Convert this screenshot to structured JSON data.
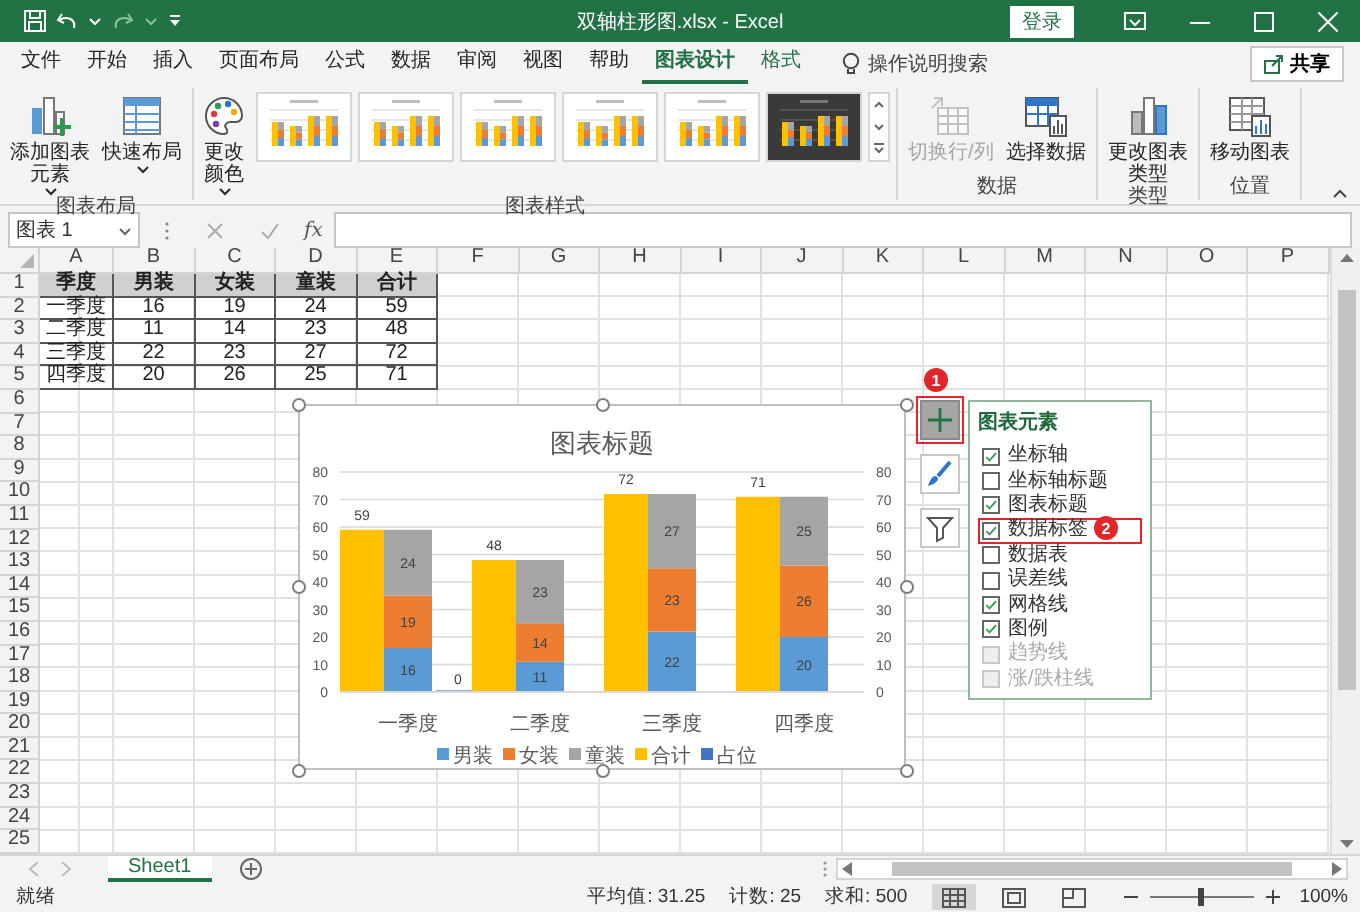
{
  "title_bar": {
    "title": "双轴柱形图.xlsx - Excel",
    "login_button": "登录"
  },
  "ribbon_tabs": [
    {
      "label": "文件",
      "selected": false,
      "contextual": false
    },
    {
      "label": "开始",
      "selected": false,
      "contextual": false
    },
    {
      "label": "插入",
      "selected": false,
      "contextual": false
    },
    {
      "label": "页面布局",
      "selected": false,
      "contextual": false
    },
    {
      "label": "公式",
      "selected": false,
      "contextual": false
    },
    {
      "label": "数据",
      "selected": false,
      "contextual": false
    },
    {
      "label": "审阅",
      "selected": false,
      "contextual": false
    },
    {
      "label": "视图",
      "selected": false,
      "contextual": false
    },
    {
      "label": "帮助",
      "selected": false,
      "contextual": false
    },
    {
      "label": "图表设计",
      "selected": true,
      "contextual": true
    },
    {
      "label": "格式",
      "selected": false,
      "contextual": true
    }
  ],
  "tell_me": {
    "placeholder": "操作说明搜索"
  },
  "share_button": "共享",
  "ribbon_groups": [
    {
      "label": "图表布局",
      "buttons": [
        {
          "kind": "add_element",
          "label": "添加图表元素",
          "disabled": false,
          "has_menu": true
        },
        {
          "kind": "quick_layout",
          "label": "快速布局",
          "disabled": false,
          "has_menu": true
        }
      ]
    },
    {
      "label": "图表样式",
      "buttons": [
        {
          "kind": "change_colors",
          "label": "更改颜色",
          "disabled": false,
          "has_menu": true
        }
      ],
      "styles": [
        {
          "kind": "light"
        },
        {
          "kind": "light"
        },
        {
          "kind": "light"
        },
        {
          "kind": "light"
        },
        {
          "kind": "light"
        },
        {
          "kind": "dark"
        }
      ]
    },
    {
      "label": "数据",
      "buttons": [
        {
          "kind": "switch_row_column",
          "label": "切换行/列",
          "disabled": true,
          "has_menu": false
        },
        {
          "kind": "select_data",
          "label": "选择数据",
          "disabled": false,
          "has_menu": false
        }
      ]
    },
    {
      "label": "类型",
      "buttons": [
        {
          "kind": "change_type",
          "label": "更改图表类型",
          "disabled": false,
          "has_menu": false
        }
      ]
    },
    {
      "label": "位置",
      "buttons": [
        {
          "kind": "move_chart",
          "label": "移动图表",
          "disabled": false,
          "has_menu": false
        }
      ]
    }
  ],
  "formula_bar": {
    "name_box": "图表 1",
    "function_button": "fx"
  },
  "sheet": {
    "columns": [
      "A",
      "B",
      "C",
      "D",
      "E",
      "F",
      "G",
      "H",
      "I",
      "J",
      "K",
      "L",
      "M",
      "N",
      "O",
      "P"
    ],
    "rows": [
      "1",
      "2",
      "3",
      "4",
      "5",
      "6",
      "7",
      "8",
      "9",
      "10",
      "11",
      "12",
      "13",
      "14",
      "15",
      "16",
      "17",
      "18",
      "19",
      "20",
      "21",
      "22",
      "23",
      "24",
      "25"
    ],
    "table": [
      [
        "季度",
        "男装",
        "女装",
        "童装",
        "合计"
      ],
      [
        "一季度",
        "16",
        "19",
        "24",
        "59"
      ],
      [
        "二季度",
        "11",
        "14",
        "23",
        "48"
      ],
      [
        "三季度",
        "22",
        "23",
        "27",
        "72"
      ],
      [
        "四季度",
        "20",
        "26",
        "25",
        "71"
      ]
    ]
  },
  "chart": {
    "selected": true,
    "chart_data": {
      "type": "bar",
      "title": "图表标题",
      "categories": [
        "一季度",
        "二季度",
        "三季度",
        "四季度"
      ],
      "series": [
        {
          "name": "男装",
          "color": "#5b9bd5",
          "values": [
            16,
            11,
            22,
            20
          ],
          "axis": "y2",
          "value_labels": [
            "16",
            "11",
            "22",
            "20"
          ]
        },
        {
          "name": "女装",
          "color": "#ed7d31",
          "values": [
            19,
            14,
            23,
            26
          ],
          "axis": "y2",
          "value_labels": [
            "19",
            "14",
            "23",
            "26"
          ]
        },
        {
          "name": "童装",
          "color": "#a5a5a5",
          "values": [
            24,
            23,
            27,
            25
          ],
          "axis": "y2",
          "value_labels": [
            "24",
            "23",
            "27",
            "25"
          ]
        },
        {
          "name": "合计",
          "color": "#ffc000",
          "values": [
            59,
            48,
            72,
            71
          ],
          "value_labels": [
            "59",
            "48",
            "72",
            "71"
          ]
        },
        {
          "name": "占位",
          "color": "#4472c4",
          "values": [
            0,
            null,
            null,
            null
          ]
        }
      ],
      "annotations": [
        "0"
      ],
      "ylim": [
        0,
        80
      ],
      "yticks": [
        {
          "value": 0,
          "label": "0"
        },
        {
          "value": 10,
          "label": "10"
        },
        {
          "value": 20,
          "label": "20"
        },
        {
          "value": 30,
          "label": "30"
        },
        {
          "value": 40,
          "label": "40"
        },
        {
          "value": 50,
          "label": "50"
        },
        {
          "value": 60,
          "label": "60"
        },
        {
          "value": 70,
          "label": "70"
        },
        {
          "value": 80,
          "label": "80"
        }
      ],
      "y2lim": [
        0,
        80
      ],
      "y2ticks": [
        {
          "value": 0,
          "label": "0"
        },
        {
          "value": 10,
          "label": "10"
        },
        {
          "value": 20,
          "label": "20"
        },
        {
          "value": 30,
          "label": "30"
        },
        {
          "value": 40,
          "label": "40"
        },
        {
          "value": 50,
          "label": "50"
        },
        {
          "value": 60,
          "label": "60"
        },
        {
          "value": 70,
          "label": "70"
        },
        {
          "value": 80,
          "label": "80"
        }
      ],
      "stacked": true,
      "grid": true,
      "legend": "bottom"
    }
  },
  "chart_buttons": [
    {
      "kind": "elements",
      "selected": true,
      "highlighted": true
    },
    {
      "kind": "styles",
      "selected": false,
      "highlighted": false
    },
    {
      "kind": "filter",
      "selected": false,
      "highlighted": false
    }
  ],
  "elements_panel": {
    "title": "图表元素",
    "items": [
      {
        "label": "坐标轴",
        "checked": true,
        "disabled": false,
        "highlighted": false
      },
      {
        "label": "坐标轴标题",
        "checked": false,
        "disabled": false,
        "highlighted": false
      },
      {
        "label": "图表标题",
        "checked": true,
        "disabled": false,
        "highlighted": false
      },
      {
        "label": "数据标签",
        "checked": true,
        "disabled": false,
        "highlighted": true
      },
      {
        "label": "数据表",
        "checked": false,
        "disabled": false,
        "highlighted": false
      },
      {
        "label": "误差线",
        "checked": false,
        "disabled": false,
        "highlighted": false
      },
      {
        "label": "网格线",
        "checked": true,
        "disabled": false,
        "highlighted": false
      },
      {
        "label": "图例",
        "checked": true,
        "disabled": false,
        "highlighted": false
      },
      {
        "label": "趋势线",
        "checked": false,
        "disabled": true,
        "highlighted": false
      },
      {
        "label": "涨/跌柱线",
        "checked": false,
        "disabled": true,
        "highlighted": false
      }
    ]
  },
  "callouts": [
    {
      "text": "1"
    },
    {
      "text": "2"
    }
  ],
  "sheet_tabs": [
    {
      "label": "Sheet1",
      "selected": true
    }
  ],
  "status_bar": {
    "status": "就绪",
    "stats": [
      "平均值: 31.25",
      "计数: 25",
      "求和: 500"
    ],
    "views": [
      {
        "kind": "normal",
        "selected": true
      },
      {
        "kind": "page_layout",
        "selected": false
      },
      {
        "kind": "page_break_preview",
        "selected": false
      }
    ],
    "zoom": {
      "level": 0.5,
      "reading": "100%"
    }
  }
}
